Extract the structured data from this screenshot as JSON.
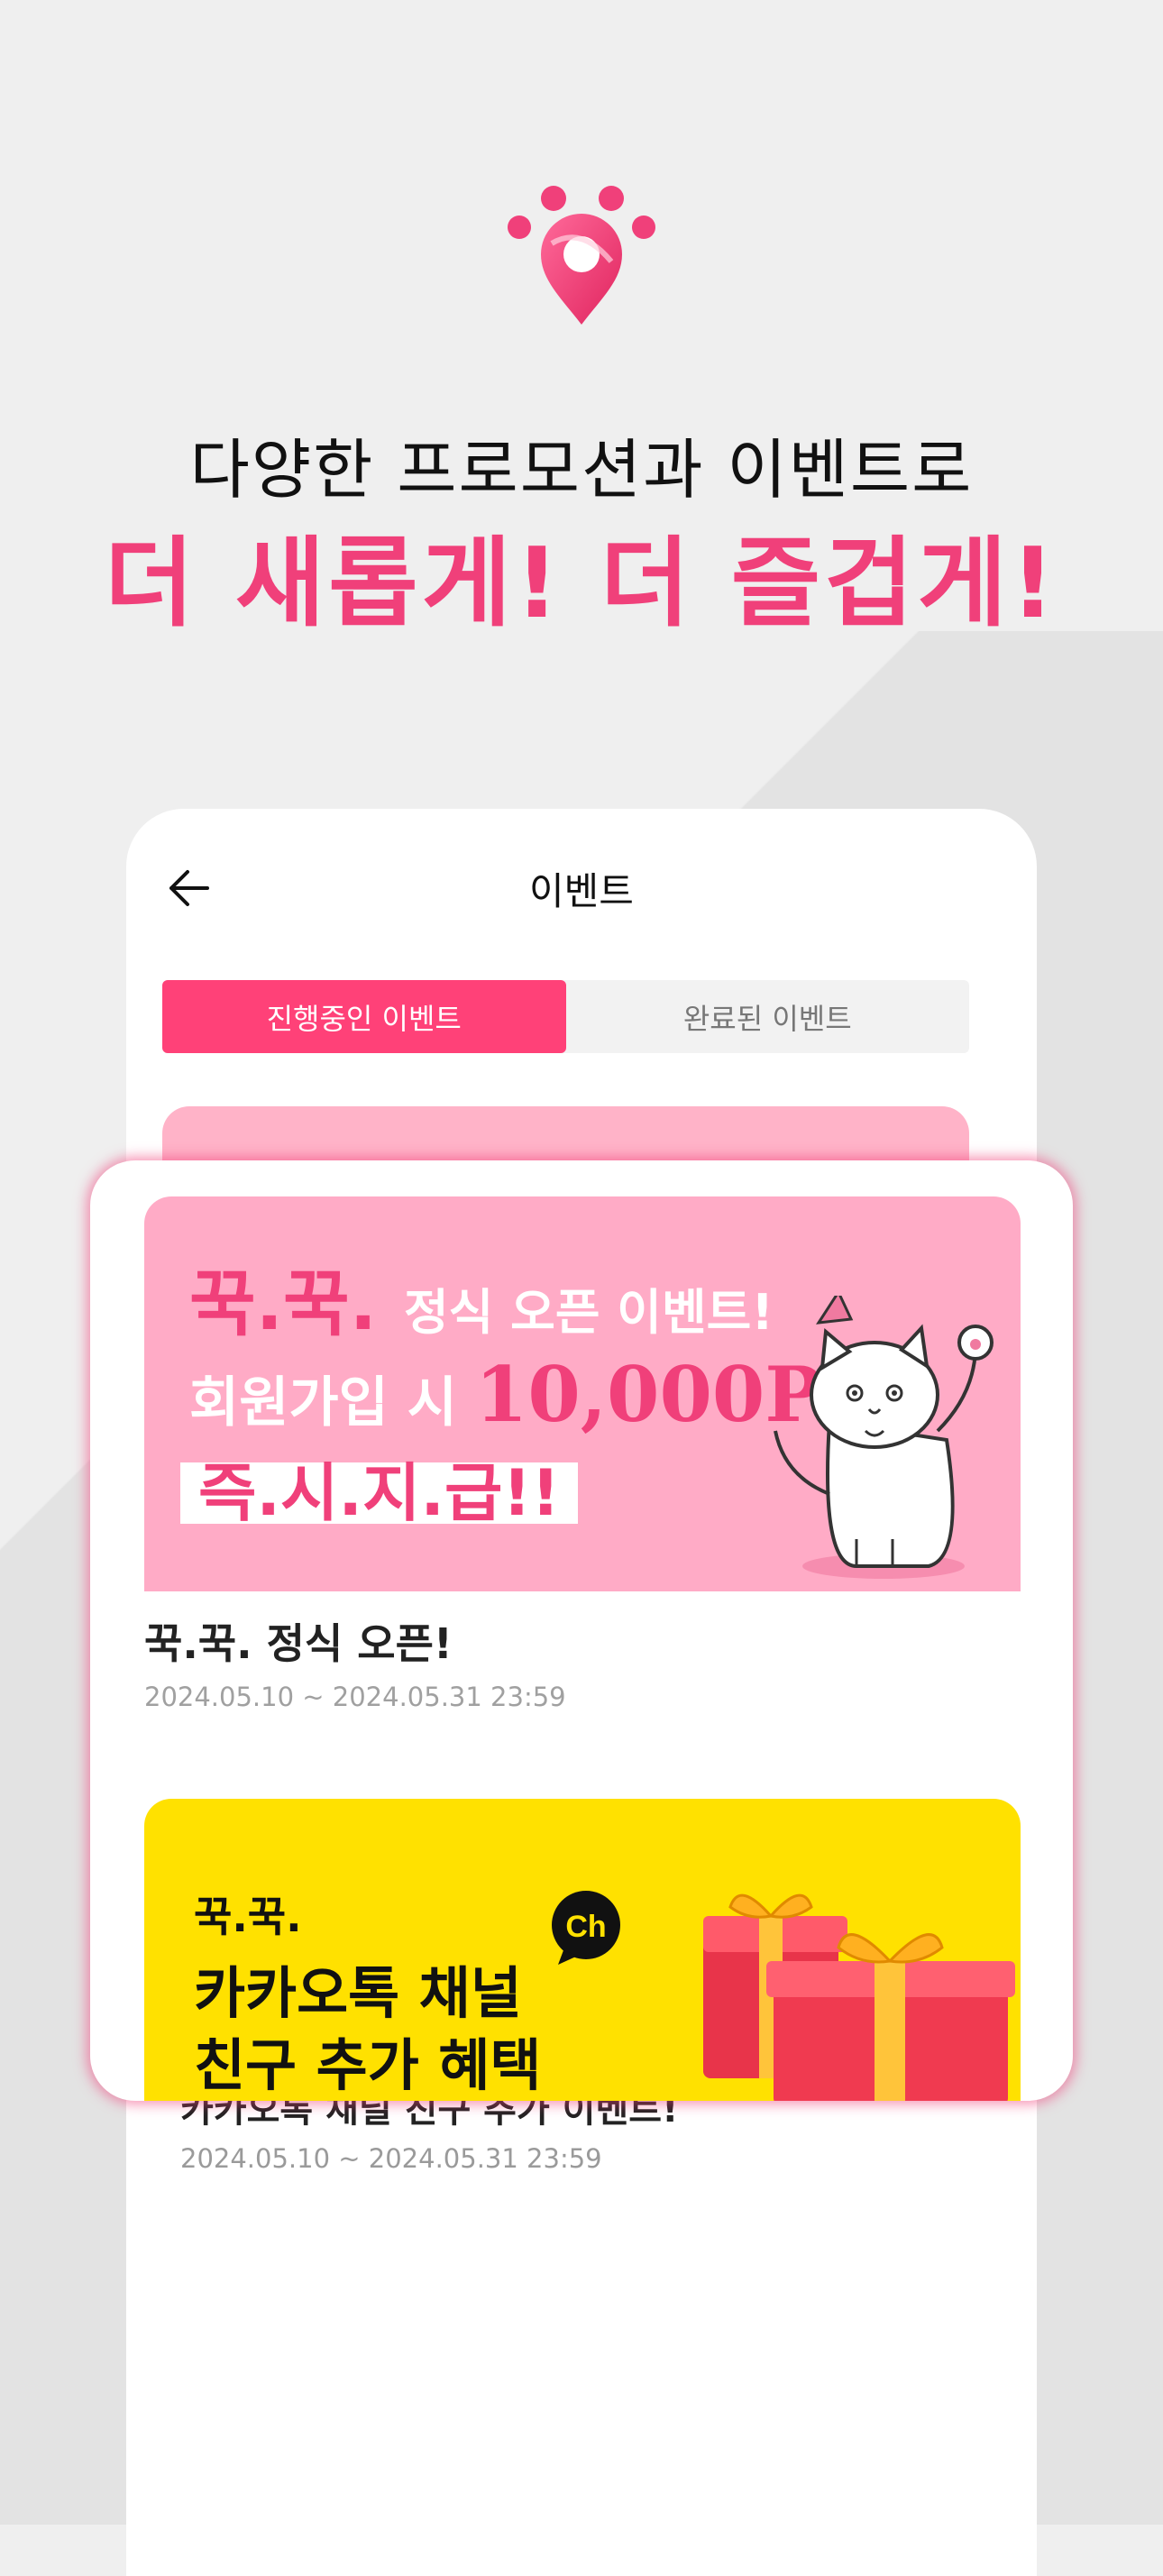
{
  "hero": {
    "line1": "다양한 프로모션과 이벤트로",
    "line2": "더 새롭게! 더 즐겁게!"
  },
  "nav": {
    "title": "이벤트"
  },
  "tabs": [
    {
      "label": "진행중인 이벤트",
      "active": true
    },
    {
      "label": "완료된 이벤트",
      "active": false
    }
  ],
  "events": [
    {
      "banner": {
        "brand": "꾹.꾹.",
        "headline": "정식 오픈 이벤트!",
        "join_text": "회원가입 시",
        "points": "10,000P",
        "instant": "즉.시.지.급!!"
      },
      "title": "꾹.꾹. 정식 오픈!",
      "date": "2024.05.10 ~ 2024.05.31 23:59"
    },
    {
      "banner": {
        "brand": "꾹.꾹.",
        "line1": "카카오톡 채널",
        "line2": "친구 추가 혜택",
        "badge": "Ch"
      },
      "title": "카카오톡 채널 친구 추가 이벤트!",
      "date": "2024.05.10 ~ 2024.05.31 23:59"
    }
  ],
  "colors": {
    "accent": "#f0407a",
    "tab_active": "#ff4178",
    "banner1_bg": "#ffabc6",
    "banner2_bg": "#ffe100"
  }
}
